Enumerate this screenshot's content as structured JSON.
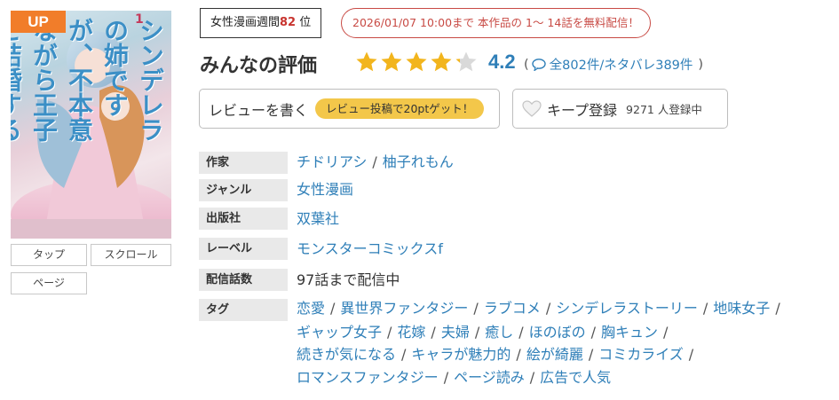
{
  "cover": {
    "up_label": "UP",
    "title_text": "シンデレラの姉ですが、不本意ながら王子と結婚することになりました",
    "volume": "1"
  },
  "reading_modes": [
    "タップ",
    "スクロール",
    "ページ"
  ],
  "rank": {
    "prefix": "女性漫画週間",
    "number": "82",
    "suffix": "位"
  },
  "campaign": "2026/01/07 10:00まで 本作品の 1～ 14話を無料配信！",
  "rating": {
    "title": "みんなの評価",
    "score": "4.2",
    "stars_value": 4.2,
    "stars_max": 5,
    "open_paren": "(",
    "reviews": "全802件/ネタバレ389件",
    "close_paren": ")"
  },
  "review_button": {
    "label": "レビューを書く",
    "point_label": "レビュー投稿で20ptゲット！"
  },
  "keep_button": {
    "label": "キープ登録",
    "count": "9271 人登録中"
  },
  "info": {
    "author": {
      "label": "作家",
      "values": [
        "チドリアシ",
        "柚子れもん"
      ]
    },
    "genre": {
      "label": "ジャンル",
      "value": "女性漫画"
    },
    "publisher": {
      "label": "出版社",
      "value": "双葉社"
    },
    "label": {
      "label": "レーベル",
      "value": "モンスターコミックスf"
    },
    "episodes": {
      "label": "配信話数",
      "value": "97話まで配信中"
    },
    "tags": {
      "label": "タグ",
      "lines": [
        [
          "恋愛",
          "異世界ファンタジー",
          "ラブコメ",
          "シンデレラストーリー",
          "地味女子"
        ],
        [
          "ギャップ女子",
          "花嫁",
          "夫婦",
          "癒し",
          "ほのぼの",
          "胸キュン"
        ],
        [
          "続きが気になる",
          "キャラが魅力的",
          "絵が綺麗",
          "コミカライズ"
        ],
        [
          "ロマンスファンタジー",
          "ページ読み",
          "広告で人気"
        ]
      ]
    }
  },
  "colors": {
    "accent_blue": "#2f7fb8",
    "up_orange": "#f17d2a",
    "star_gold": "#f2b51d",
    "campaign_red": "#c84a44",
    "pill_yellow": "#f3c74a"
  }
}
